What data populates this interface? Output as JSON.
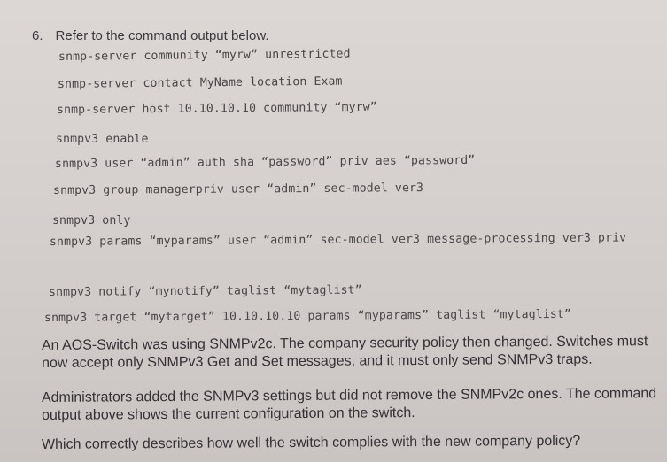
{
  "question": {
    "number": "6.",
    "prompt": "Refer to the command output below."
  },
  "config_lines": [
    "snmp-server community “myrw” unrestricted",
    "snmp-server contact MyName location Exam",
    "snmp-server host 10.10.10.10 community “myrw”",
    "snmpv3 enable",
    "snmpv3 user “admin” auth sha “password” priv aes “password”",
    "snmpv3 group managerpriv user “admin” sec-model ver3",
    "snmpv3 only",
    "snmpv3 params “myparams” user “admin” sec-model ver3 message-processing ver3 priv",
    "snmpv3 notify “mynotify” taglist “mytaglist”",
    "snmpv3 target “mytarget” 10.10.10.10 params “myparams” taglist “mytaglist”"
  ],
  "paragraphs": [
    "An AOS-Switch was using SNMPv2c. The company security policy then changed. Switches must now accept only SNMPv3 Get and Set messages, and it must only send SNMPv3 traps.",
    "Administrators added the SNMPv3 settings but did not remove the SNMPv2c ones. The command output above shows the current configuration on the switch.",
    "Which correctly describes how well the switch complies with the new company policy?"
  ]
}
